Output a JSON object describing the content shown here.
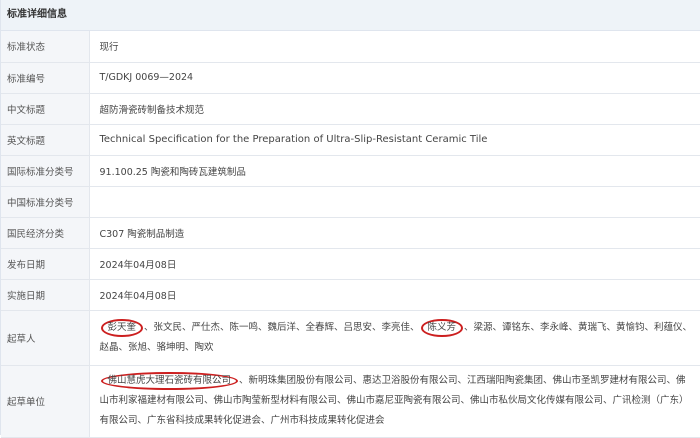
{
  "header": {
    "title": "标准详细信息"
  },
  "rows": [
    {
      "label": "标准状态",
      "value": "现行"
    },
    {
      "label": "标准编号",
      "value": "T/GDKJ 0069—2024"
    },
    {
      "label": "中文标题",
      "value": "超防滑瓷砖制备技术规范"
    },
    {
      "label": "英文标题",
      "value": "Technical Specification for the Preparation of Ultra-Slip-Resistant Ceramic Tile"
    },
    {
      "label": "国际标准分类号",
      "value": "91.100.25 陶瓷和陶砖瓦建筑制品"
    },
    {
      "label": "中国标准分类号",
      "value": ""
    },
    {
      "label": "国民经济分类",
      "value": "C307 陶瓷制品制造"
    },
    {
      "label": "发布日期",
      "value": "2024年04月08日"
    },
    {
      "label": "实施日期",
      "value": "2024年04月08日"
    }
  ],
  "drafters": {
    "label": "起草人",
    "circled1": "彭天奎",
    "text1": "、张文民、严仕杰、陈一鸣、魏后洋、全春辉、吕思安、李亮佳、",
    "circled2": "陈义芳",
    "text2": "、梁源、谭铭东、李永峰、黄瑞飞、黄愉钧、利蕴仪、赵晶、张旭、骆坤明、陶欢"
  },
  "units": {
    "label": "起草单位",
    "circled1": "佛山慧虎大理石瓷砖有限公司",
    "text1": "、新明珠集团股份有限公司、惠达卫浴股份有限公司、江西瑞阳陶瓷集团、佛山市圣凯罗建材有限公司、佛山市利家福建材有限公司、佛山市陶莹新型材料有限公司、佛山市嘉尼亚陶瓷有限公司、佛山市私伙局文化传媒有限公司、广讯检测（广东）有限公司、广东省科技成果转化促进会、广州市科技成果转化促进会"
  }
}
